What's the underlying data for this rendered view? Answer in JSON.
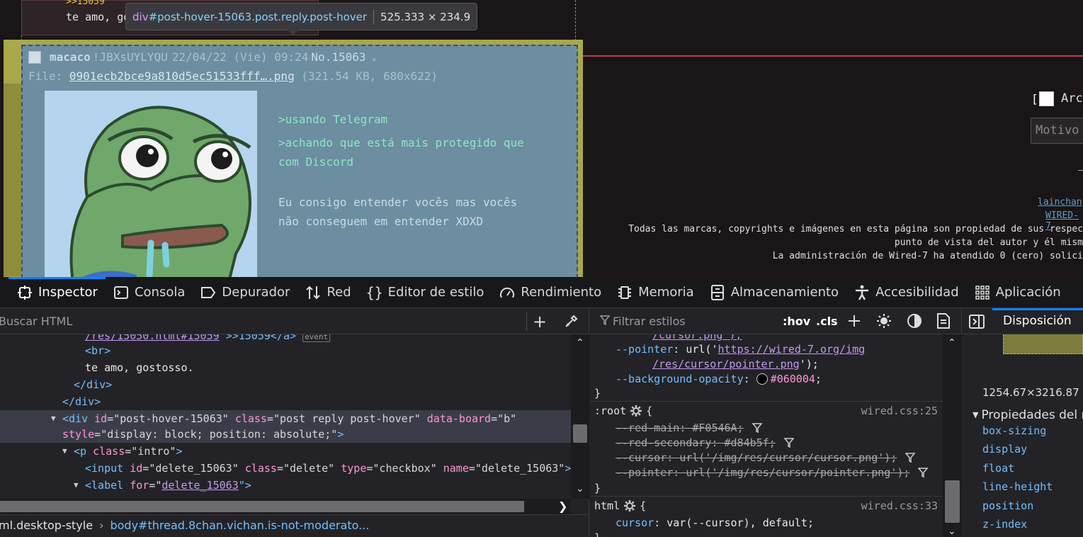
{
  "page": {
    "prev_post": {
      "quote": ">>15059",
      "text": "te amo, gostosso."
    },
    "tooltip": {
      "tag": "div",
      "selector": "#post-hover-15063.post.reply.post-hover",
      "dims": "525.333 × 234.9"
    },
    "hover_post": {
      "name": "macaco",
      "trip": "!JBXsUYLYQU",
      "date": "22/04/22 (Vie) 09:24",
      "number": "No.15063",
      "file_label": "File:",
      "file_name": "0901ecb2bce9a810d5ec51533fff….png",
      "file_info": "(321.54 KB, 680x622)",
      "body": [
        ">usando Telegram",
        ">achando que está mais protegido que com Discord",
        "Eu consigo entender vocês mas vocês não conseguem em entender XDXD"
      ]
    },
    "right_panel": {
      "bracket": "[",
      "checkbox_label": "Arc",
      "motivo_placeholder": "Motivo",
      "dash": "–",
      "link1": "lainchan",
      "link2": "WIRED-7",
      "footer_lines": [
        "Todas las marcas, copyrights e imágenes en esta página son propiedad de sus respec",
        "punto de vista del autor y él mism",
        "La administración de Wired-7 ha atendido 0 (cero) solici"
      ]
    }
  },
  "devtools": {
    "tabs": [
      {
        "label": "Inspector",
        "icon": "inspector-icon"
      },
      {
        "label": "Consola",
        "icon": "console-icon"
      },
      {
        "label": "Depurador",
        "icon": "debugger-icon"
      },
      {
        "label": "Red",
        "icon": "network-icon"
      },
      {
        "label": "Editor de estilo",
        "icon": "style-editor-icon"
      },
      {
        "label": "Rendimiento",
        "icon": "performance-icon"
      },
      {
        "label": "Memoria",
        "icon": "memory-icon"
      },
      {
        "label": "Almacenamiento",
        "icon": "storage-icon"
      },
      {
        "label": "Accesibilidad",
        "icon": "accessibility-icon"
      },
      {
        "label": "Aplicación",
        "icon": "application-icon"
      }
    ],
    "inspector": {
      "search_placeholder": "Buscar HTML",
      "markup": {
        "l0_link": "/res/15050.html#15059",
        "l0_text": " >>15059</a>",
        "l0_badge": "event",
        "l1": "<br>",
        "l2": "te amo, gostosso.",
        "l3": "</div>",
        "l4": "</div>",
        "l5_tag": "<div",
        "l5_a1n": " id",
        "l5_a1v": "\"post-hover-15063\"",
        "l5_a2n": " class",
        "l5_a2v": "\"post reply post-hover\"",
        "l5_a3n": " data-board",
        "l5_a3v": "\"b\"",
        "l6_a4n": "style",
        "l6_a4v": "\"display: block; position: absolute;\"",
        "l6_end": ">",
        "l7_tag": "<p",
        "l7_a1n": " class",
        "l7_a1v": "\"intro\"",
        "l7_end": ">",
        "l8_tag": "<input",
        "l8_a1n": " id",
        "l8_a1v": "\"delete_15063\"",
        "l8_a2n": " class",
        "l8_a2v": "\"delete\"",
        "l8_a3n": " type",
        "l8_a3v": "\"checkbox\"",
        "l8_a4n": " name",
        "l8_a4v": "\"delete_15063\"",
        "l8_end": ">",
        "l9_tag": "<label",
        "l9_a1n": " for",
        "l9_link": "delete_15063",
        "l9_end": "\">"
      },
      "breadcrumb_1": "ml.desktop-style",
      "breadcrumb_2": "body#thread.8chan.vichan.is-not-moderato..."
    },
    "rules": {
      "filter_placeholder": "Filtrar estilos",
      "hov": ":hov",
      "cls": ".cls",
      "r0": "/cursor.png');",
      "r1_name": "--pointer",
      "r1_url": "https://wired-7.org/img",
      "r1_url2": "/res/cursor/pointer.png",
      "r2_name": "--background-opacity",
      "r2_val": "#060004",
      "brace_close": "}",
      "root_sel": ":root",
      "root_src": "wired.css:25",
      "root_props": [
        {
          "name": "--red-main",
          "value": "#F0546A"
        },
        {
          "name": "--red-secondary",
          "value": "#d84b5f"
        },
        {
          "name": "--cursor",
          "value": "url('/img/res/cursor/cursor.png')"
        },
        {
          "name": "--pointer",
          "value": "url('/img/res/cursor/pointer.png')"
        }
      ],
      "html_sel": "html",
      "html_src": "wired.css:33",
      "html_prop_name": "cursor",
      "html_prop_val": "var(--cursor), default"
    },
    "layout": {
      "tab": "Disposición",
      "size": "1254.67×3216.87",
      "props_heading": "Propiedades del m",
      "props": [
        "box-sizing",
        "display",
        "float",
        "line-height",
        "position",
        "z-index"
      ]
    }
  }
}
